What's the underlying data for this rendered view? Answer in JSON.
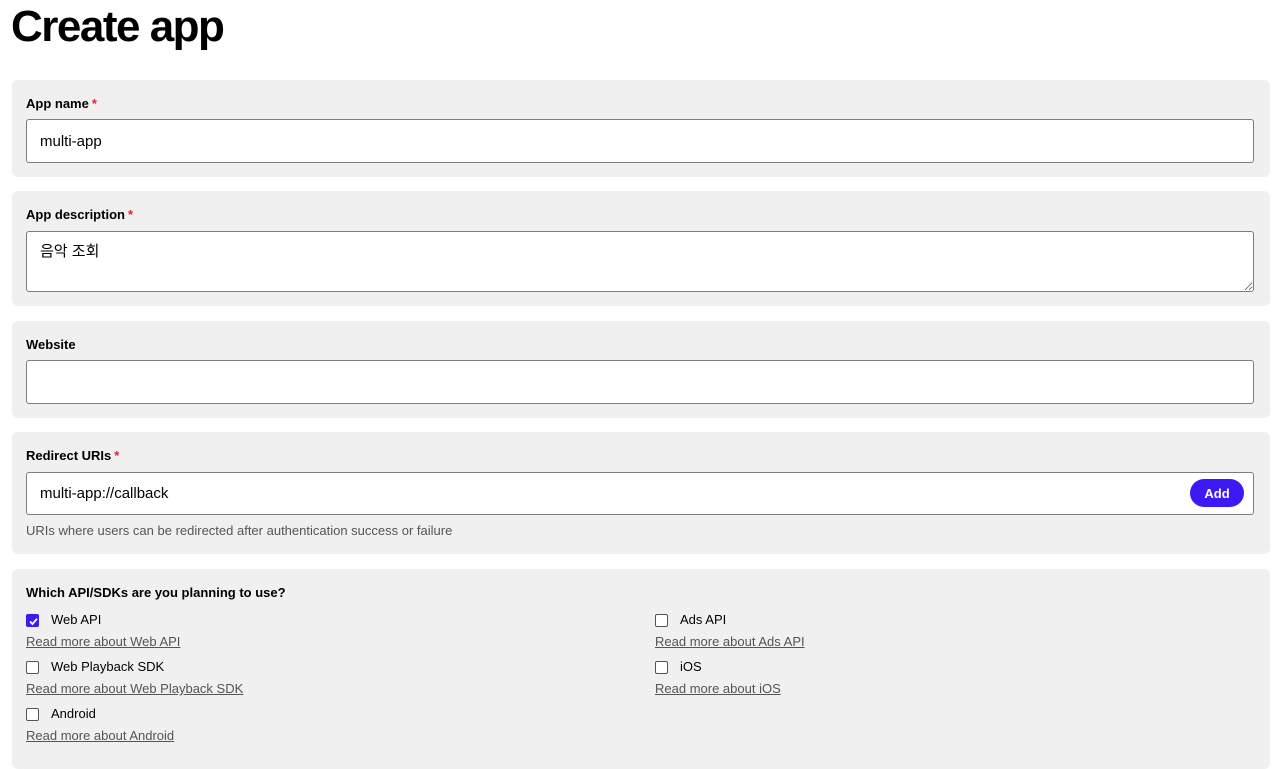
{
  "page": {
    "title": "Create app"
  },
  "app_name": {
    "label": "App name",
    "required_mark": "*",
    "value": "multi-app"
  },
  "app_description": {
    "label": "App description",
    "required_mark": "*",
    "value": "음악 조회"
  },
  "website": {
    "label": "Website",
    "value": ""
  },
  "redirect_uris": {
    "label": "Redirect URIs",
    "required_mark": "*",
    "value": "multi-app://callback",
    "add_label": "Add",
    "helper": "URIs where users can be redirected after authentication success or failure"
  },
  "apis": {
    "label": "Which API/SDKs are you planning to use?",
    "options": [
      {
        "label": "Web API",
        "link": "Read more about Web API",
        "checked": true
      },
      {
        "label": "Ads API",
        "link": "Read more about Ads API",
        "checked": false
      },
      {
        "label": "Web Playback SDK",
        "link": "Read more about Web Playback SDK",
        "checked": false
      },
      {
        "label": "iOS",
        "link": "Read more about iOS",
        "checked": false
      },
      {
        "label": "Android",
        "link": "Read more about Android",
        "checked": false
      }
    ]
  },
  "colors": {
    "accent": "#3c19f5",
    "required": "#e22134",
    "card_bg": "#f0f0f0"
  }
}
